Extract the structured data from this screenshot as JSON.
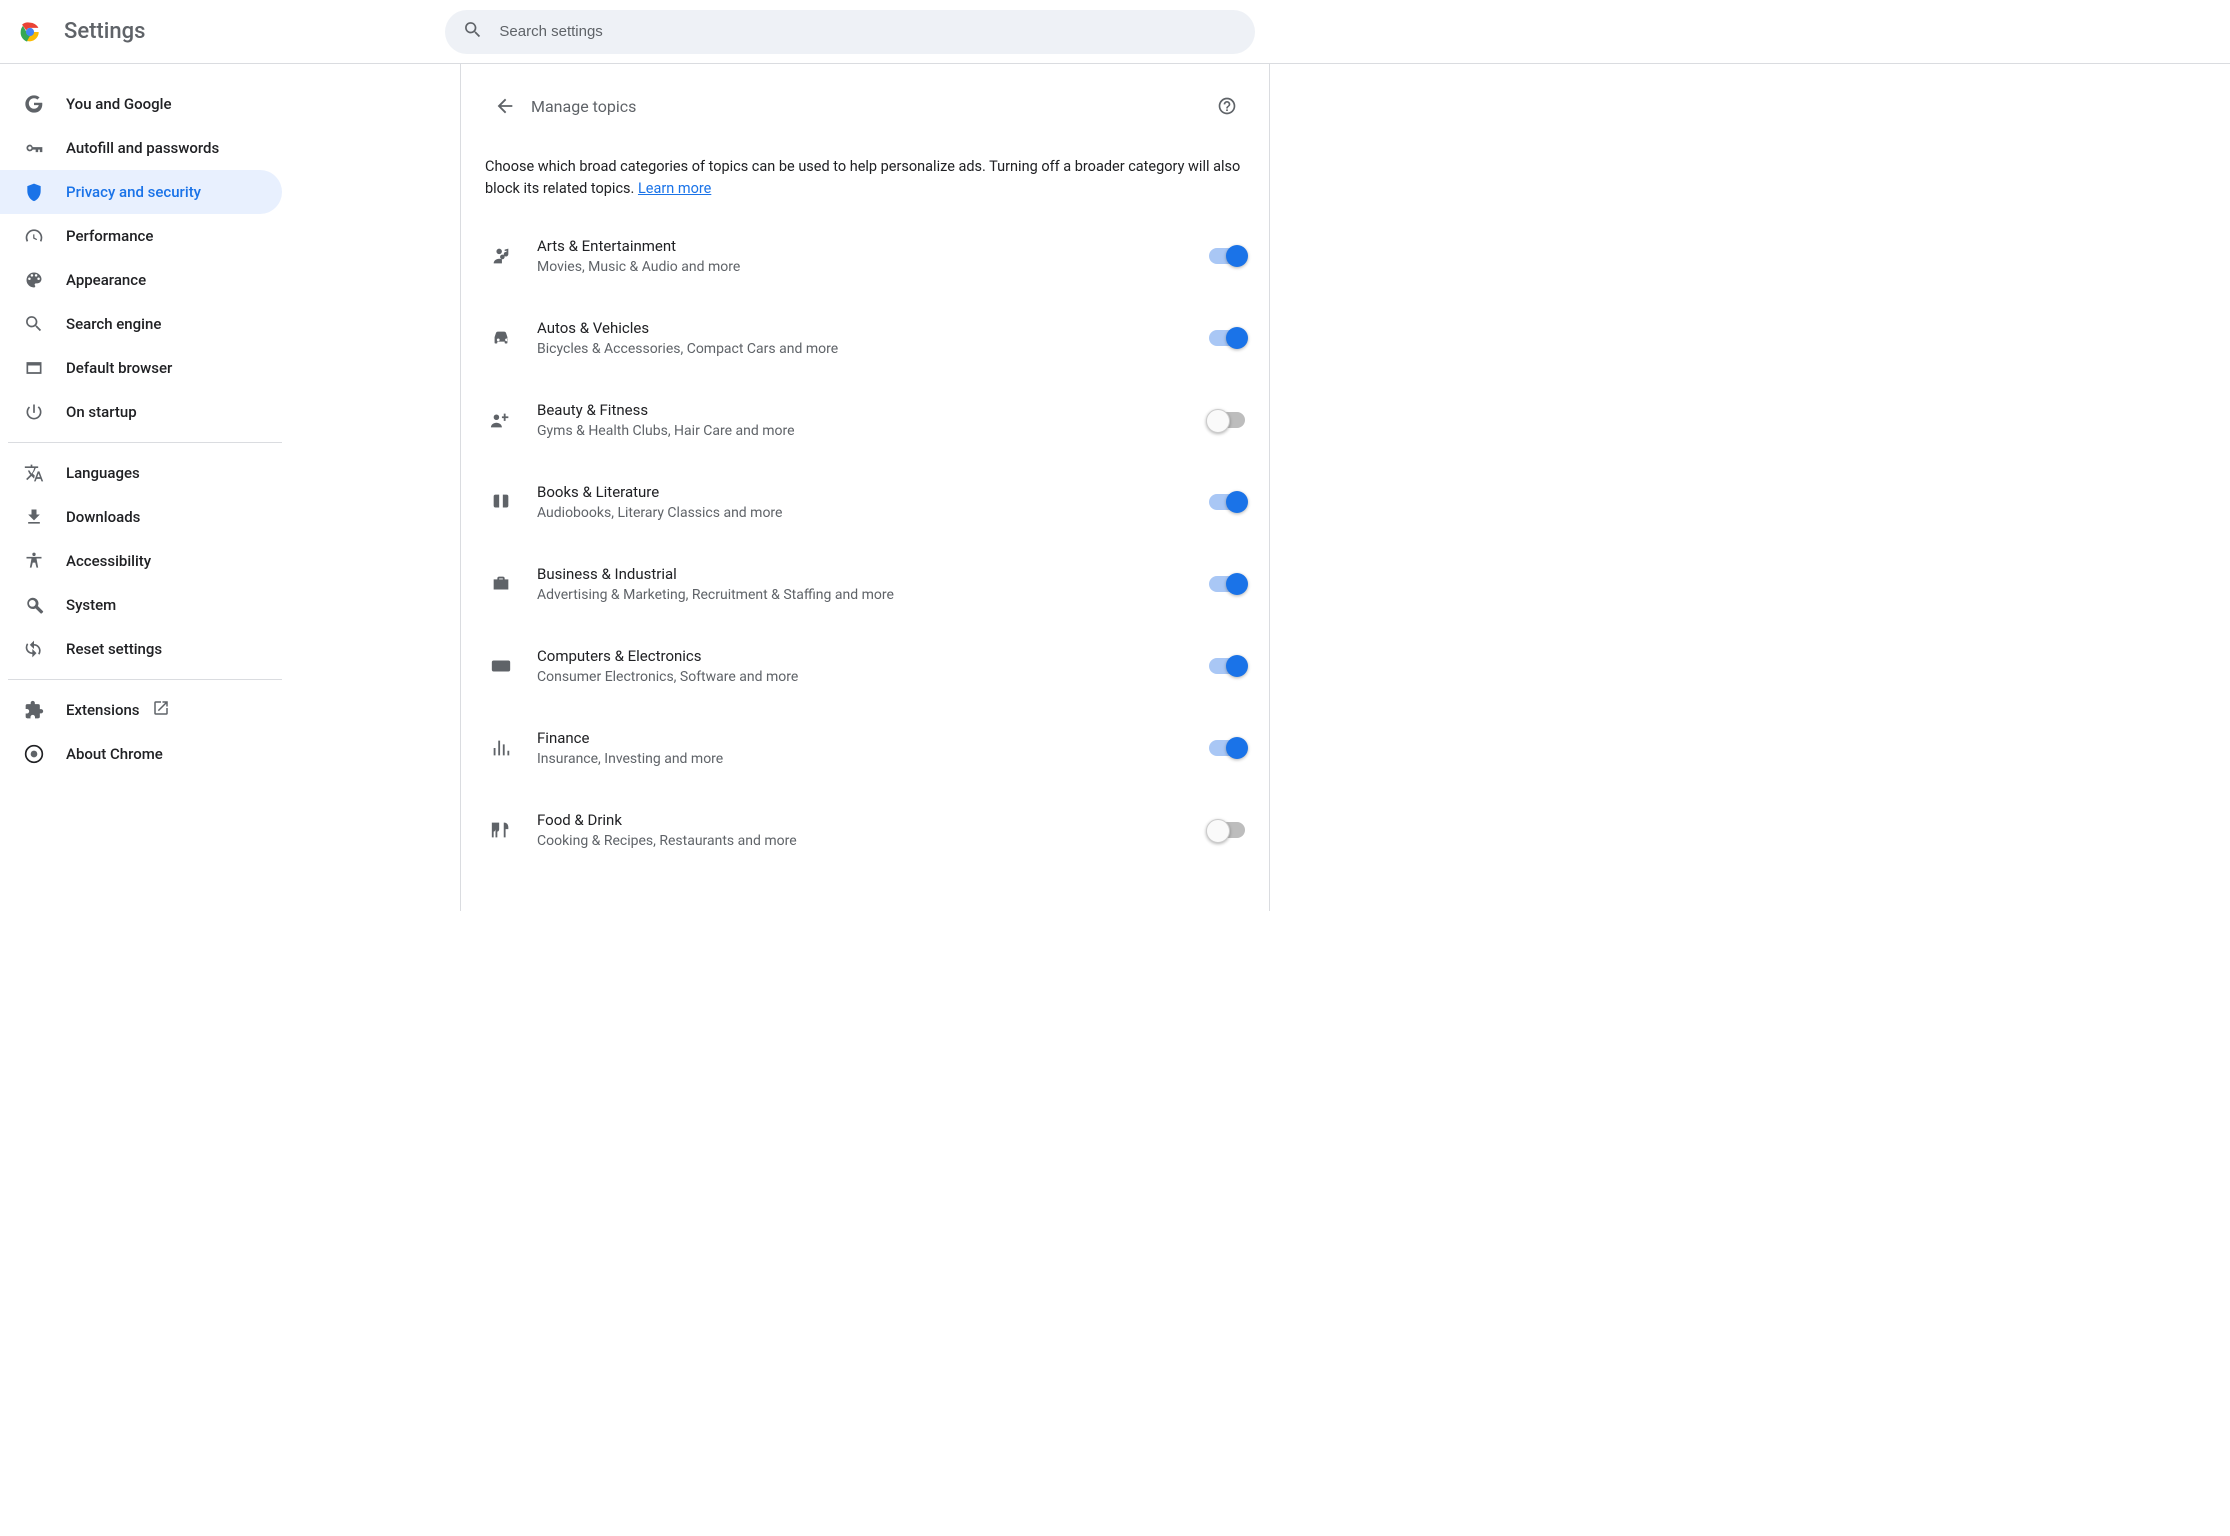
{
  "app_title": "Settings",
  "search": {
    "placeholder": "Search settings"
  },
  "sidebar": {
    "groups": [
      [
        {
          "key": "you-google",
          "label": "You and Google"
        },
        {
          "key": "autofill",
          "label": "Autofill and passwords"
        },
        {
          "key": "privacy",
          "label": "Privacy and security",
          "selected": true
        },
        {
          "key": "performance",
          "label": "Performance"
        },
        {
          "key": "appearance",
          "label": "Appearance"
        },
        {
          "key": "search-engine",
          "label": "Search engine"
        },
        {
          "key": "default-browser",
          "label": "Default browser"
        },
        {
          "key": "on-startup",
          "label": "On startup"
        }
      ],
      [
        {
          "key": "languages",
          "label": "Languages"
        },
        {
          "key": "downloads",
          "label": "Downloads"
        },
        {
          "key": "accessibility",
          "label": "Accessibility"
        },
        {
          "key": "system",
          "label": "System"
        },
        {
          "key": "reset",
          "label": "Reset settings"
        }
      ],
      [
        {
          "key": "extensions",
          "label": "Extensions",
          "external": true
        },
        {
          "key": "about",
          "label": "About Chrome"
        }
      ]
    ]
  },
  "page": {
    "title": "Manage topics",
    "intro_text": "Choose which broad categories of topics can be used to help personalize ads. Turning off a broader category will also block its related topics. ",
    "learn_more": "Learn more"
  },
  "topics": [
    {
      "key": "arts",
      "title": "Arts & Entertainment",
      "subtitle": "Movies, Music & Audio and more",
      "on": true
    },
    {
      "key": "autos",
      "title": "Autos & Vehicles",
      "subtitle": "Bicycles & Accessories, Compact Cars and more",
      "on": true
    },
    {
      "key": "beauty",
      "title": "Beauty & Fitness",
      "subtitle": "Gyms & Health Clubs, Hair Care and more",
      "on": false
    },
    {
      "key": "books",
      "title": "Books & Literature",
      "subtitle": "Audiobooks, Literary Classics and more",
      "on": true
    },
    {
      "key": "business",
      "title": "Business & Industrial",
      "subtitle": "Advertising & Marketing, Recruitment & Staffing and more",
      "on": true
    },
    {
      "key": "computers",
      "title": "Computers & Electronics",
      "subtitle": "Consumer Electronics, Software and more",
      "on": true
    },
    {
      "key": "finance",
      "title": "Finance",
      "subtitle": "Insurance, Investing and more",
      "on": true
    },
    {
      "key": "food",
      "title": "Food & Drink",
      "subtitle": "Cooking & Recipes, Restaurants and more",
      "on": false
    }
  ]
}
